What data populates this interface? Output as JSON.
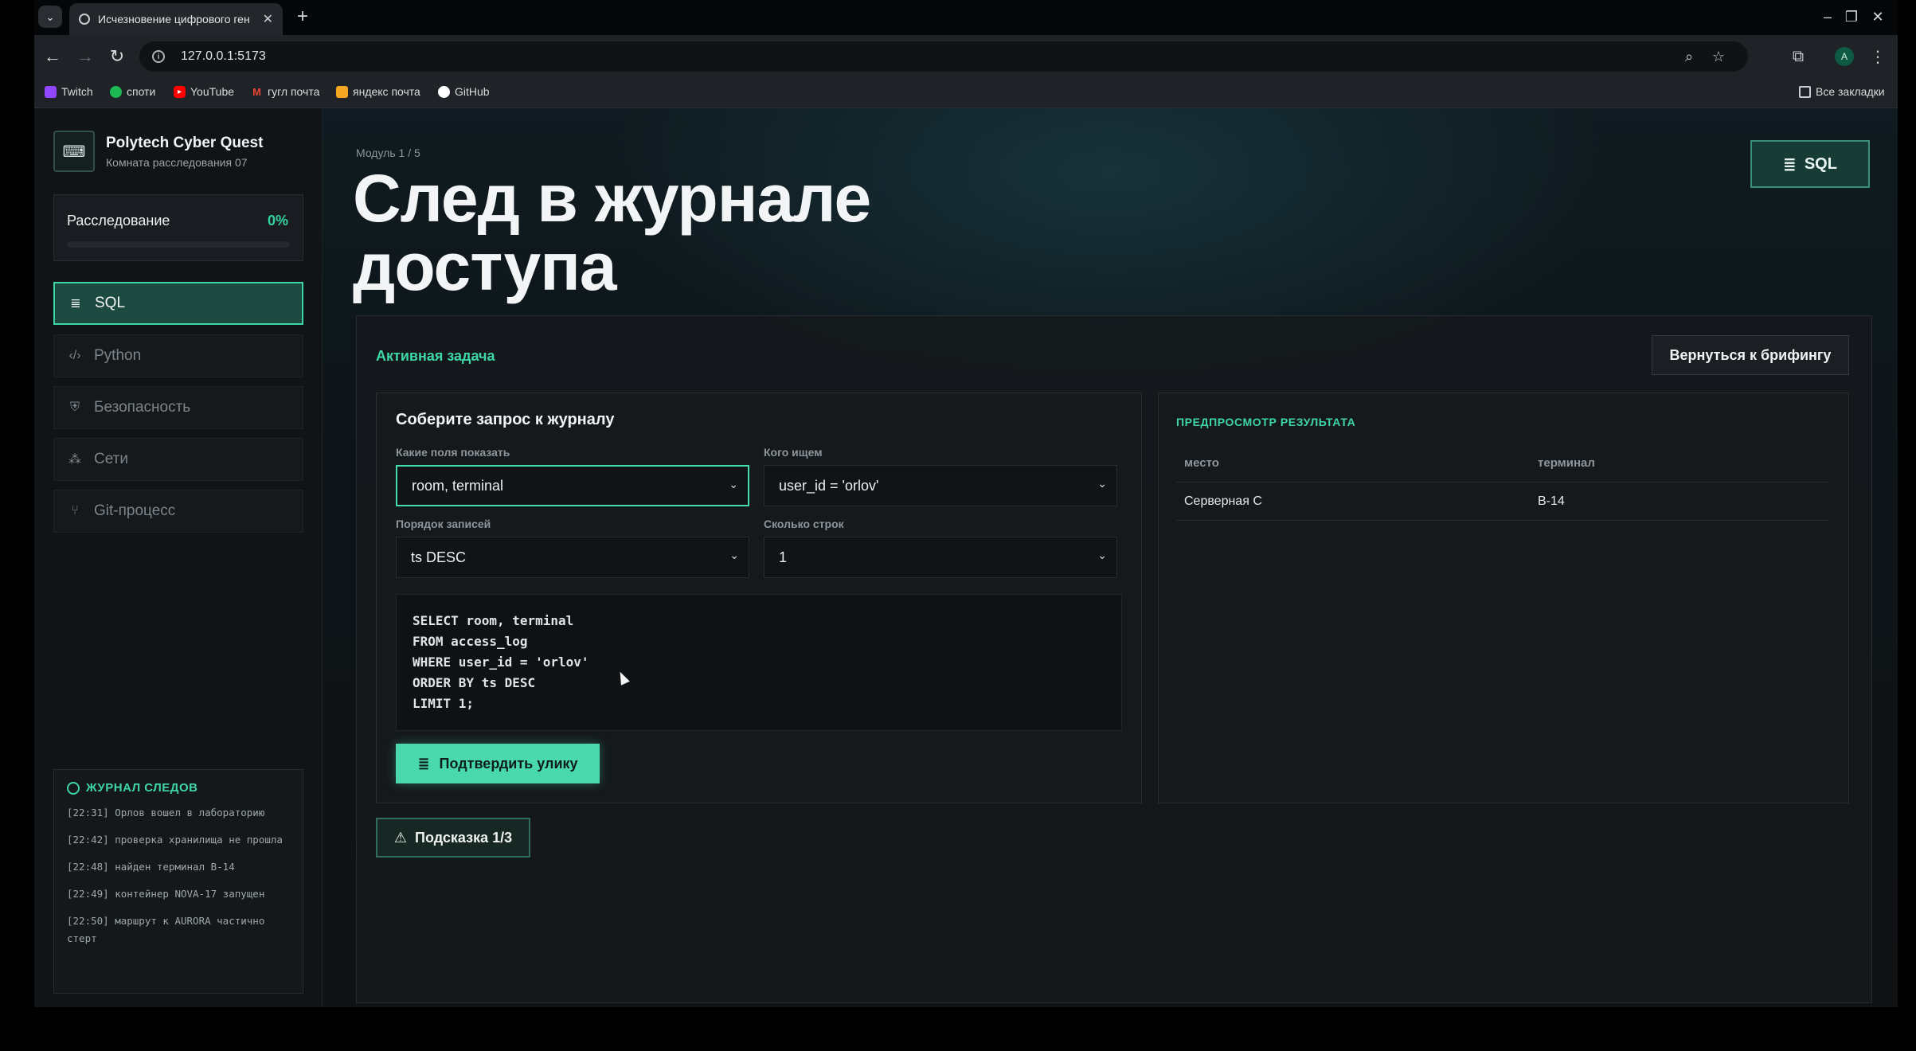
{
  "browser": {
    "tab_title": "Исчезновение цифрового ген",
    "url": "127.0.0.1:5173",
    "bookmarks": [
      {
        "label": "Twitch",
        "icon": "twitch-icon",
        "color": "#9146ff"
      },
      {
        "label": "споти",
        "icon": "spotify-icon",
        "color": "#1db954"
      },
      {
        "label": "YouTube",
        "icon": "youtube-icon",
        "color": "#ff0000"
      },
      {
        "label": "гугл почта",
        "icon": "gmail-icon",
        "color": "#ea4335"
      },
      {
        "label": "яндекс почта",
        "icon": "yandex-mail-icon",
        "color": "#f5a623"
      },
      {
        "label": "GitHub",
        "icon": "github-icon",
        "color": "#ffffff"
      }
    ],
    "all_bookmarks": "Все закладки",
    "profile_initial": "A"
  },
  "sidebar": {
    "brand_title": "Polytech Cyber Quest",
    "brand_sub": "Комната расследования 07",
    "progress_label": "Расследование",
    "progress_value": "0%",
    "progress_fraction": 0,
    "nav": [
      {
        "label": "SQL",
        "icon": "database-icon",
        "active": true
      },
      {
        "label": "Python",
        "icon": "code-icon",
        "active": false
      },
      {
        "label": "Безопасность",
        "icon": "shield-icon",
        "active": false
      },
      {
        "label": "Сети",
        "icon": "network-icon",
        "active": false
      },
      {
        "label": "Git-процесс",
        "icon": "git-branch-icon",
        "active": false
      }
    ],
    "trace_title": "ЖУРНАЛ СЛЕДОВ",
    "trace": [
      "[22:31] Орлов вошел в лабораторию",
      "[22:42] проверка хранилища не прошла",
      "[22:48] найден терминал B-14",
      "[22:49] контейнер NOVA-17 запущен",
      "[22:50] маршрут к AURORA частично стерт"
    ]
  },
  "main": {
    "module": "Модуль 1 / 5",
    "title": "След в журнале доступа",
    "badge": "SQL",
    "task_label": "Активная задача",
    "back_button": "Вернуться к брифингу",
    "builder": {
      "title": "Соберите запрос к журналу",
      "fields_label": "Какие поля показать",
      "fields_value": "room, terminal",
      "who_label": "Кого ищем",
      "who_value": "user_id = 'orlov'",
      "order_label": "Порядок записей",
      "order_value": "ts DESC",
      "rows_label": "Сколько строк",
      "rows_value": "1",
      "code": [
        "SELECT room, terminal",
        "FROM access_log",
        "WHERE user_id = 'orlov'",
        "ORDER BY ts DESC",
        "LIMIT 1;"
      ],
      "confirm_button": "Подтвердить улику"
    },
    "preview": {
      "title": "ПРЕДПРОСМОТР РЕЗУЛЬТАТА",
      "columns": [
        "место",
        "терминал"
      ],
      "rows": [
        [
          "Серверная C",
          "B-14"
        ]
      ]
    },
    "hint_button": "Подсказка 1/3"
  },
  "colors": {
    "accent": "#3fd6a5",
    "background": "#0e1418"
  }
}
